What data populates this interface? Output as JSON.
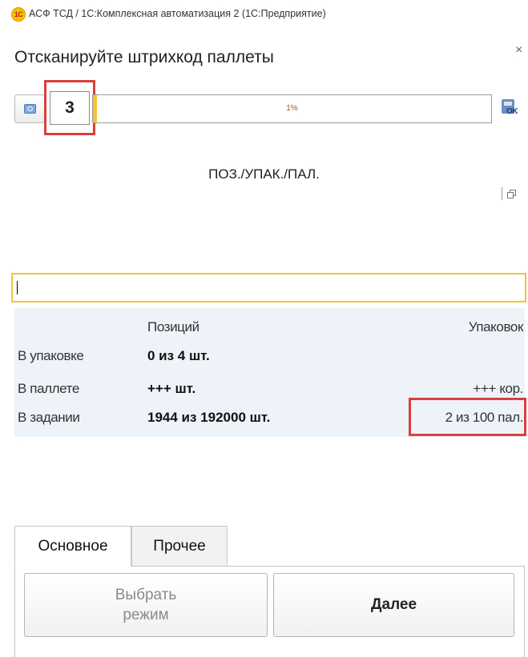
{
  "window": {
    "app_icon_text": "1С",
    "title": "АСФ ТСД / 1С:Комплексная автоматизация 2  (1С:Предприятие)"
  },
  "form": {
    "title": "Отсканируйте штрихкод паллеты",
    "close_glyph": "×"
  },
  "barcode_row": {
    "count_value": "3",
    "progress_text": "1%",
    "progress_fraction": 0.01,
    "accent_color": "#f3c23c",
    "highlight_color": "#d9403d"
  },
  "mode_label": "ПОЗ./УПАК./ПАЛ.",
  "info": {
    "header_positions": "Позиций",
    "header_packages": "Упаковок",
    "rows": [
      {
        "label": "В упаковке",
        "positions": "0 из 4 шт.",
        "packages": ""
      },
      {
        "label": "В паллете",
        "positions": "+++ шт.",
        "packages": "+++ кор."
      },
      {
        "label": "В задании",
        "positions": "1944 из 192000 шт.",
        "packages": "2 из 100 пал."
      }
    ]
  },
  "tabs": [
    {
      "label": "Основное",
      "active": true
    },
    {
      "label": "Прочее",
      "active": false
    }
  ],
  "buttons": {
    "select_mode_line1": "Выбрать",
    "select_mode_line2": "режим",
    "next": "Далее"
  }
}
